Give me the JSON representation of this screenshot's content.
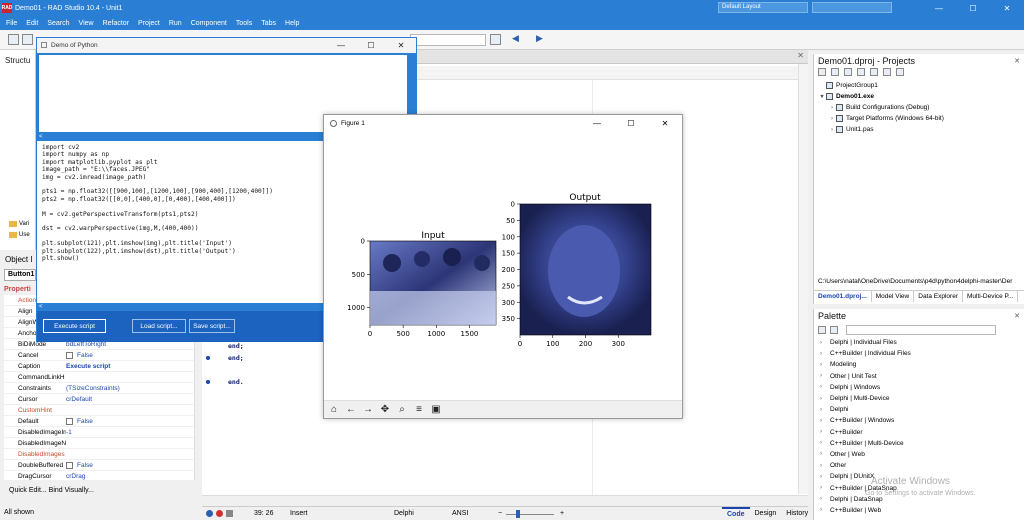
{
  "ide": {
    "title": "Demo01 - RAD Studio 10.4 - Unit1",
    "logo": "RAD",
    "layout": "Default Layout",
    "menu": [
      "File",
      "Edit",
      "Search",
      "View",
      "Refactor",
      "Project",
      "Run",
      "Component",
      "Tools",
      "Tabs",
      "Help"
    ]
  },
  "structure": {
    "title": "Structu",
    "tree": [
      "Vari",
      "Use"
    ]
  },
  "object_inspector": {
    "title": "Object I",
    "component": "Button1",
    "tab": "Properti",
    "properties": [
      {
        "name": "Action",
        "value": "",
        "checkbox": false,
        "red": true,
        "bold": false
      },
      {
        "name": "Align",
        "value": "",
        "checkbox": false,
        "red": false,
        "bold": false
      },
      {
        "name": "AlignW",
        "value": "",
        "checkbox": false,
        "red": false,
        "bold": false
      },
      {
        "name": "Anchors",
        "value": "",
        "checkbox": false,
        "red": false,
        "bold": false
      },
      {
        "name": "BiDiMode",
        "value": "bdLeftToRight",
        "checkbox": false,
        "red": false,
        "bold": false
      },
      {
        "name": "Cancel",
        "value": "False",
        "checkbox": true,
        "red": false,
        "bold": false
      },
      {
        "name": "Caption",
        "value": "Execute script",
        "checkbox": false,
        "red": false,
        "bold": true
      },
      {
        "name": "CommandLinkH",
        "value": "",
        "checkbox": false,
        "red": false,
        "bold": false
      },
      {
        "name": "Constraints",
        "value": "(TSizeConstraints)",
        "checkbox": false,
        "red": false,
        "bold": false
      },
      {
        "name": "Cursor",
        "value": "crDefault",
        "checkbox": false,
        "red": false,
        "bold": false
      },
      {
        "name": "CustomHint",
        "value": "",
        "checkbox": false,
        "red": true,
        "bold": false
      },
      {
        "name": "Default",
        "value": "False",
        "checkbox": true,
        "red": false,
        "bold": false
      },
      {
        "name": "DisabledImageIn",
        "value": "-1",
        "checkbox": false,
        "red": false,
        "bold": false
      },
      {
        "name": "DisabledImageN",
        "value": "",
        "checkbox": false,
        "red": false,
        "bold": false
      },
      {
        "name": "DisabledImages",
        "value": "",
        "checkbox": false,
        "red": true,
        "bold": false
      },
      {
        "name": "DoubleBuffered",
        "value": "False",
        "checkbox": true,
        "red": false,
        "bold": false
      },
      {
        "name": "DragCursor",
        "value": "crDrag",
        "checkbox": false,
        "red": false,
        "bold": false
      }
    ],
    "quick_edit": "Quick Edit... Bind Visually...",
    "all_shown": "All shown"
  },
  "editor": {
    "lines": [
      {
        "dot": false,
        "text": "end;"
      },
      {
        "dot": true,
        "text": "end;"
      },
      {
        "dot": false,
        "text": ""
      },
      {
        "dot": true,
        "text": "end."
      }
    ]
  },
  "statusbar": {
    "position": "39: 26",
    "mode": "Insert",
    "lang": "Delphi",
    "encoding": "ANSI",
    "tabs": [
      {
        "label": "Code",
        "active": true
      },
      {
        "label": "Design",
        "active": false
      },
      {
        "label": "History",
        "active": false
      }
    ]
  },
  "projects": {
    "title": "Demo01.dproj - Projects",
    "tree": [
      {
        "indent": 0,
        "caret": "",
        "label": "ProjectGroup1",
        "bold": false
      },
      {
        "indent": 0,
        "caret": "▾",
        "label": "Demo01.exe",
        "bold": true
      },
      {
        "indent": 1,
        "caret": "›",
        "label": "Build Configurations (Debug)",
        "bold": false
      },
      {
        "indent": 1,
        "caret": "›",
        "label": "Target Platforms (Windows 64-bit)",
        "bold": false
      },
      {
        "indent": 1,
        "caret": "›",
        "label": "Unit1.pas",
        "bold": false
      }
    ],
    "path": "C:\\Users\\natal\\OneDrive\\Documents\\p4d\\python4delphi-master\\Der",
    "tabs": [
      {
        "label": "Demo01.dproj...",
        "active": true
      },
      {
        "label": "Model View",
        "active": false
      },
      {
        "label": "Data Explorer",
        "active": false
      },
      {
        "label": "Multi-Device P...",
        "active": false
      }
    ]
  },
  "palette": {
    "title": "Palette",
    "items": [
      "Delphi | Individual Files",
      "C++Builder | Individual Files",
      "Modeling",
      "Other | Unit Test",
      "Delphi | Windows",
      "Delphi | Multi-Device",
      "Delphi",
      "C++Builder | Windows",
      "C++Builder",
      "C++Builder | Multi-Device",
      "Other | Web",
      "Other",
      "Delphi | DUnitX",
      "C++Builder | DataSnap",
      "Delphi | DataSnap",
      "C++Builder | Web"
    ],
    "watermark_title": "Activate Windows",
    "watermark_sub": "Go to Settings to activate Windows."
  },
  "demo": {
    "title": "Demo of Python",
    "arrow": "<",
    "code": "import cv2\nimport numpy as np\nimport matplotlib.pyplot as plt\nimage_path = \"E:\\\\faces.JPEG\"\nimg = cv2.imread(image_path)\n\npts1 = np.float32([[900,100],[1200,100],[900,400],[1200,400]])\npts2 = np.float32([[0,0],[400,0],[0,400],[400,400]])\n\nM = cv2.getPerspectiveTransform(pts1,pts2)\n\ndst = cv2.warpPerspective(img,M,(400,400))\n\nplt.subplot(121),plt.imshow(img),plt.title('Input')\nplt.subplot(122),plt.imshow(dst),plt.title('Output')\nplt.show()",
    "buttons": {
      "execute": "Execute script",
      "load": "Load script...",
      "save": "Save script..."
    }
  },
  "figure": {
    "title": "Figure 1",
    "input": {
      "title": "Input",
      "xticks": [
        "0",
        "500",
        "1000",
        "1500"
      ],
      "yticks": [
        "0",
        "500",
        "1000"
      ]
    },
    "output": {
      "title": "Output",
      "xticks": [
        "0",
        "100",
        "200",
        "300"
      ],
      "yticks": [
        "0",
        "50",
        "100",
        "150",
        "200",
        "250",
        "300",
        "350"
      ]
    }
  },
  "colors": {
    "ide_blue": "#2a7fd4",
    "demo_button_bar": "#1c63c0",
    "image_tint": "#3b4fa8"
  }
}
